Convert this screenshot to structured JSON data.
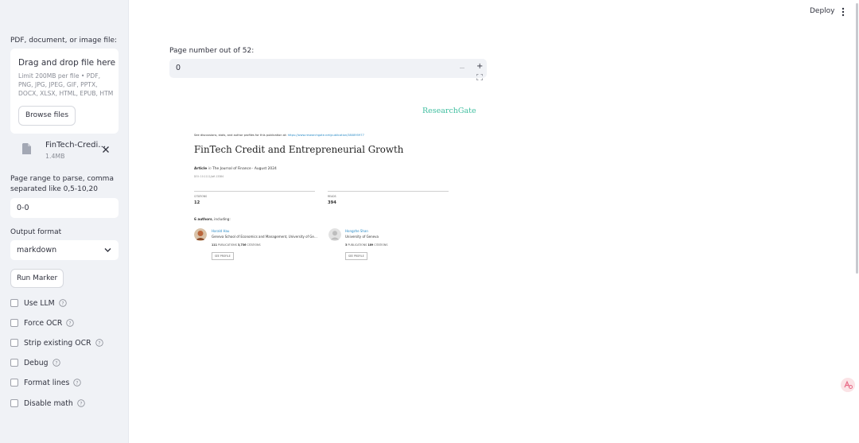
{
  "sidebar": {
    "file_label": "PDF, document, or image file:",
    "dropzone": {
      "title": "Drag and drop file here",
      "hint": "Limit 200MB per file • PDF, PNG, JPG, JPEG, GIF, PPTX, DOCX, XLSX, HTML, EPUB, HTM",
      "browse_label": "Browse files"
    },
    "file": {
      "name": "FinTech-Credi…",
      "size": "1.4MB"
    },
    "page_range_label": "Page range to parse, comma separated like 0,5-10,20",
    "page_range_value": "0-0",
    "output_format_label": "Output format",
    "output_format_value": "markdown",
    "run_label": "Run Marker",
    "checkboxes": [
      {
        "label": "Use LLM",
        "checked": false
      },
      {
        "label": "Force OCR",
        "checked": false
      },
      {
        "label": "Strip existing OCR",
        "checked": false
      },
      {
        "label": "Debug",
        "checked": false
      },
      {
        "label": "Format lines",
        "checked": false
      },
      {
        "label": "Disable math",
        "checked": false
      }
    ]
  },
  "header": {
    "deploy_label": "Deploy",
    "menu_icon": "vertical-ellipsis-icon"
  },
  "main": {
    "page_number_label": "Page number out of 52:",
    "page_number_value": "0",
    "preview": {
      "logo": "ResearchGate",
      "see_line": "See discussions, stats, and author profiles for this publication at:",
      "see_link": "https://www.researchgate.net/publication/380895977",
      "title": "FinTech Credit and Entrepreneurial Growth",
      "article_type": "Article",
      "article_in": "in",
      "article_journal": "The Journal of Finance · August 2024",
      "doi": "DOI: 10.1111/jofi.13384",
      "citations_caption": "CITATIONS",
      "citations_value": "12",
      "reads_caption": "READS",
      "reads_value": "394",
      "authors_count": "6 authors",
      "authors_suffix": ", including:",
      "authors": [
        {
          "name": "Harald Hau",
          "affiliation": "Geneva School of Economics and Management, University of Ge…",
          "pubs": "111",
          "pubs_label": "PUBLICATIONS",
          "cites": "3,736",
          "cites_label": "CITATIONS",
          "profile_label": "SEE PROFILE"
        },
        {
          "name": "Hongzhe Shan",
          "affiliation": "University of Geneva",
          "pubs": "3",
          "pubs_label": "PUBLICATIONS",
          "cites": "189",
          "cites_label": "CITATIONS",
          "profile_label": "SEE PROFILE"
        }
      ]
    }
  },
  "colors": {
    "accent_teal": "#40bfa0",
    "link_blue": "#2a8bc7",
    "sidebar_bg": "#f0f2f6"
  }
}
